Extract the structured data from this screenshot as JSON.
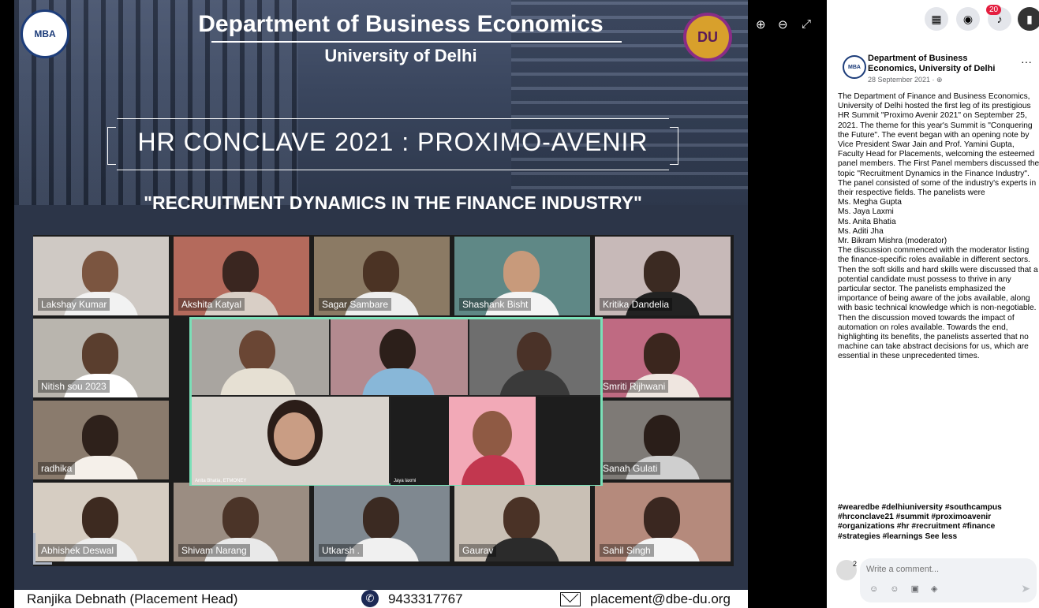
{
  "poster": {
    "left_logo": "MBA",
    "right_logo": "DU",
    "title": "Department of Business Economics",
    "university": "University of Delhi",
    "conclave": "HR CONCLAVE 2021 : PROXIMO-AVENIR",
    "subtitle": "\"RECRUITMENT DYNAMICS IN THE FINANCE INDUSTRY\"",
    "participants": {
      "row1": [
        "Lakshay Kumar",
        "Akshita Katyal",
        "Sagar Sambare",
        "Shashank Bisht",
        "Kritika Dandelia"
      ],
      "left_col": [
        "Nitish sou 2023",
        "radhika"
      ],
      "right_col": [
        "Smriti Rijhwani",
        "Sanah Gulati"
      ],
      "row4": [
        "Abhishek Deswal",
        "Shivam Narang",
        "Utkarsh .",
        "Gaurav",
        "Sahil Singh"
      ]
    },
    "panelists": {
      "anita": "Anita Bhatia, ETMONEY",
      "jaya": "Jaya laxmi"
    },
    "footer": {
      "contact": "Ranjika Debnath (Placement Head)",
      "phone": "9433317767",
      "email": "placement@dbe-du.org"
    }
  },
  "viewer_controls": {
    "zoom_in": "⊕",
    "zoom_out": "⊖",
    "expand": "⤢"
  },
  "topbar": {
    "menu_icon": "grid-menu-icon",
    "messenger_icon": "messenger-icon",
    "bell_icon": "bell-icon",
    "notifications": "20"
  },
  "post": {
    "avatar": "MBA",
    "page_name": "Department of Business Economics, University of Delhi",
    "date": "28 September 2021 · ⊕",
    "more": "···",
    "body": "The Department of Finance and Business Economics, University of Delhi hosted the first leg of its prestigious HR Summit \"Proximo Avenir 2021\" on September 25, 2021. The theme for this year's Summit is \"Conquering the Future\". The event began with an opening note by Vice President Swar Jain and Prof. Yamini Gupta, Faculty Head for Placements, welcoming the esteemed panel members. The First Panel members discussed the topic \"Recruitment Dynamics in the Finance Industry\". The panel consisted of some of the industry's experts in their respective fields. The panelists were\nMs. Megha Gupta\nMs. Jaya Laxmi\nMs. Anita Bhatia\nMs. Aditi Jha\nMr. Bikram Mishra (moderator)\nThe discussion commenced with the moderator listing the finance-specific roles available in different sectors. Then the soft skills and hard skills were discussed that a potential candidate must possess to thrive in any particular sector. The panelists emphasized the importance of being aware of the jobs available, along with basic technical knowledge which is non-negotiable. Then the discussion moved towards the impact of automation on roles available. Towards the end, highlighting its benefits, the panelists asserted that no machine can take abstract decisions for us, which are essential in these unprecedented times.",
    "hashtags": "#wearedbe #delhiuniversity #southcampus #hrconclave21 #summit #proximoavenir #organizations #hr #recruitment #finance #strategies #learnings",
    "see_less": "See less"
  },
  "comment": {
    "avatar_badge": "2",
    "placeholder": "Write a comment...",
    "icons": "☺ ☺ ▣ ◈",
    "send": "➤"
  },
  "colors": {
    "poster_bg": "#2c3548",
    "highlight_border": "#7be0b8",
    "badge": "#e41e3f"
  }
}
